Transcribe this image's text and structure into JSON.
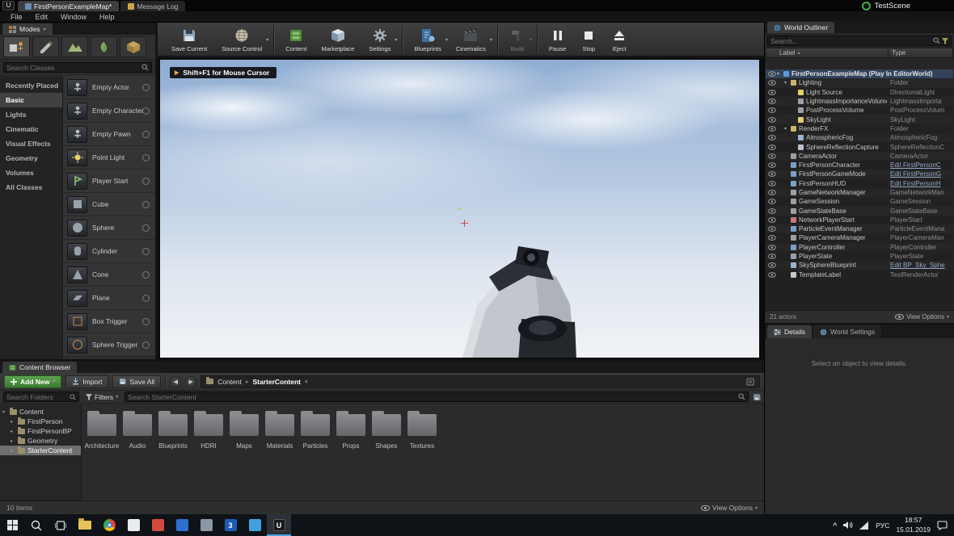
{
  "window": {
    "tabs": [
      "FirstPersonExampleMap*",
      "Message Log"
    ],
    "menu": [
      "File",
      "Edit",
      "Window",
      "Help"
    ],
    "recorder_label": "TestScene"
  },
  "modes": {
    "title": "Modes",
    "search_placeholder": "Search Classes",
    "tools": [
      "placement-tool-icon",
      "paint-tool-icon",
      "landscape-tool-icon",
      "foliage-tool-icon",
      "geometry-tool-icon"
    ],
    "selected_category": "Basic",
    "categories": [
      "Recently Placed",
      "Basic",
      "Lights",
      "Cinematic",
      "Visual Effects",
      "Geometry",
      "Volumes",
      "All Classes"
    ],
    "items": [
      "Empty Actor",
      "Empty Character",
      "Empty Pawn",
      "Point Light",
      "Player Start",
      "Cube",
      "Sphere",
      "Cylinder",
      "Cone",
      "Plane",
      "Box Trigger",
      "Sphere Trigger"
    ]
  },
  "toolbar": {
    "buttons": [
      {
        "label": "Save Current",
        "icon": "save"
      },
      {
        "label": "Source Control",
        "icon": "source",
        "caret": true
      },
      {
        "sep": true
      },
      {
        "label": "Content",
        "icon": "content"
      },
      {
        "label": "Marketplace",
        "icon": "marketplace"
      },
      {
        "label": "Settings",
        "icon": "settings",
        "caret": true
      },
      {
        "sep": true
      },
      {
        "label": "Blueprints",
        "icon": "blueprints",
        "caret": true
      },
      {
        "label": "Cinematics",
        "icon": "cinematics",
        "caret": true
      },
      {
        "sep": true
      },
      {
        "label": "Build",
        "icon": "build",
        "caret": true,
        "disabled": true
      },
      {
        "sep": true
      },
      {
        "label": "Pause",
        "icon": "pause"
      },
      {
        "label": "Stop",
        "icon": "stop"
      },
      {
        "label": "Eject",
        "icon": "eject"
      }
    ]
  },
  "viewport": {
    "hint": "Shift+F1 for Mouse Cursor"
  },
  "outliner": {
    "title": "World Outliner",
    "search_placeholder": "Search...",
    "columns": [
      "Label",
      "Type"
    ],
    "status": "21 actors",
    "view_options": "View Options",
    "rows": [
      {
        "label": "FirstPersonExampleMap (Play In EditorWorld)",
        "type": "",
        "level": 0,
        "icon": "world",
        "expand": true
      },
      {
        "label": "Lighting",
        "type": "Folder",
        "level": 1,
        "icon": "folder",
        "expand": true
      },
      {
        "label": "Light Source",
        "type": "DirectionalLight",
        "level": 2,
        "icon": "light"
      },
      {
        "label": "LightmassImportanceVolume",
        "type": "LightmassImporta",
        "level": 2,
        "icon": "volume"
      },
      {
        "label": "PostProcessVolume",
        "type": "PostProcessVolum",
        "level": 2,
        "icon": "volume"
      },
      {
        "label": "SkyLight",
        "type": "SkyLight",
        "level": 2,
        "icon": "light"
      },
      {
        "label": "RenderFX",
        "type": "Folder",
        "level": 1,
        "icon": "folder",
        "expand": true
      },
      {
        "label": "AtmosphericFog",
        "type": "AtmosphericFog",
        "level": 2,
        "icon": "fog"
      },
      {
        "label": "SphereReflectionCapture",
        "type": "SphereReflectionC",
        "level": 2,
        "icon": "sphere"
      },
      {
        "label": "CameraActor",
        "type": "CameraActor",
        "level": 1,
        "icon": "camera"
      },
      {
        "label": "FirstPersonCharacter",
        "type": "Edit FirstPersonC",
        "level": 1,
        "icon": "actor",
        "link": true
      },
      {
        "label": "FirstPersonGameMode",
        "type": "Edit FirstPersonG",
        "level": 1,
        "icon": "actor",
        "link": true
      },
      {
        "label": "FirstPersonHUD",
        "type": "Edit FirstPersonH",
        "level": 1,
        "icon": "actor",
        "link": true
      },
      {
        "label": "GameNetworkManager",
        "type": "GameNetworkMan",
        "level": 1,
        "icon": "session"
      },
      {
        "label": "GameSession",
        "type": "GameSession",
        "level": 1,
        "icon": "session"
      },
      {
        "label": "GameStateBase",
        "type": "GameStateBase",
        "level": 1,
        "icon": "session"
      },
      {
        "label": "NetworkPlayerStart",
        "type": "PlayerStart",
        "level": 1,
        "icon": "start"
      },
      {
        "label": "ParticleEventManager",
        "type": "ParticleEventMana",
        "level": 1,
        "icon": "actor"
      },
      {
        "label": "PlayerCameraManager",
        "type": "PlayerCameraMan",
        "level": 1,
        "icon": "camera"
      },
      {
        "label": "PlayerController",
        "type": "PlayerController",
        "level": 1,
        "icon": "actor"
      },
      {
        "label": "PlayerState",
        "type": "PlayerState",
        "level": 1,
        "icon": "session"
      },
      {
        "label": "SkySphereBlueprint",
        "type": "Edit BP_Sky_Sphe",
        "level": 1,
        "icon": "sky",
        "link": true
      },
      {
        "label": "TemplateLabel",
        "type": "TextRenderActor",
        "level": 1,
        "icon": "text"
      }
    ]
  },
  "details": {
    "tabs": [
      "Details",
      "World Settings"
    ],
    "message": "Select an object to view details."
  },
  "content": {
    "title": "Content Browser",
    "add_new": "Add New",
    "import": "Import",
    "save_all": "Save All",
    "breadcrumb": [
      "Content",
      "StarterContent"
    ],
    "filters": "Filters",
    "search_folders_placeholder": "Search Folders",
    "search_placeholder": "Search StarterContent",
    "tree": [
      {
        "label": "Content",
        "level": 0,
        "expand": true
      },
      {
        "label": "FirstPerson",
        "level": 1
      },
      {
        "label": "FirstPersonBP",
        "level": 1
      },
      {
        "label": "Geometry",
        "level": 1
      },
      {
        "label": "StarterContent",
        "level": 1,
        "selected": true
      }
    ],
    "folders": [
      "Architecture",
      "Audio",
      "Blueprints",
      "HDRI",
      "Maps",
      "Materials",
      "Particles",
      "Props",
      "Shapes",
      "Textures"
    ],
    "status": "10 items",
    "view_options": "View Options"
  },
  "taskbar": {
    "apps": [
      "file-explorer",
      "chrome",
      "text-editor",
      "red-app",
      "blue-app",
      "gray-app",
      "app-3",
      "mail-app",
      "unreal-editor"
    ],
    "active_app": "unreal-editor",
    "tray_lang": "РУС",
    "tray_time": "18:57",
    "tray_date": "15.01.2019"
  }
}
